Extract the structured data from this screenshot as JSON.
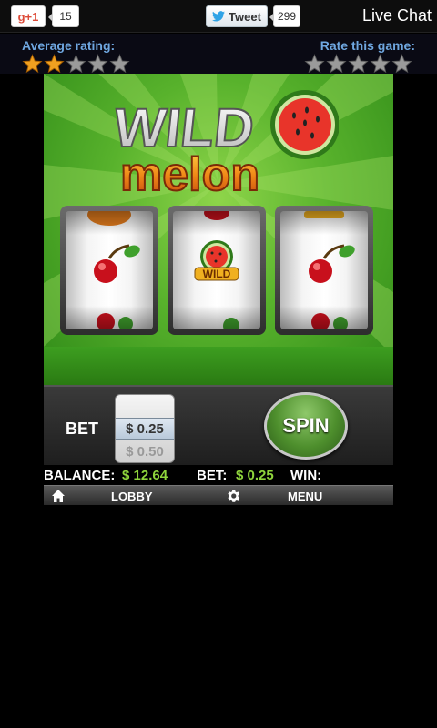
{
  "social": {
    "gplus_label": "g+1",
    "gplus_count": "15",
    "tweet_label": "Tweet",
    "tweet_count": "299",
    "live_chat": "Live Chat"
  },
  "rating": {
    "average_label": "Average rating:",
    "average_stars_filled": 2,
    "stars_total": 5,
    "rate_label": "Rate this game:",
    "rate_stars_filled": 0
  },
  "game": {
    "logo_line1": "WILD",
    "logo_line2": "melon",
    "reels": [
      {
        "symbols": [
          "orange",
          "cherry",
          "cherry-pair"
        ]
      },
      {
        "symbols": [
          "red",
          "wild-melon",
          "cherry"
        ]
      },
      {
        "symbols": [
          "wild-partial",
          "cherry",
          "cherry-pair"
        ]
      }
    ],
    "wild_label": "WILD"
  },
  "controls": {
    "bet_label": "BET",
    "bet_options": [
      "$ 0.25",
      "$ 0.50"
    ],
    "bet_selected": "$ 0.25",
    "bet_next": "$ 0.50",
    "spin_label": "SPIN"
  },
  "info": {
    "balance_label": "BALANCE:",
    "balance_value": "$ 12.64",
    "bet_label": "BET:",
    "bet_value": "$ 0.25",
    "win_label": "WIN:",
    "win_value": ""
  },
  "menubar": {
    "home_icon": "home-icon",
    "lobby_label": "LOBBY",
    "settings_icon": "gear-icon",
    "menu_label": "MENU"
  },
  "colors": {
    "accent_green": "#8fd43c",
    "label_blue": "#6fa7e0",
    "star_gold": "#f0a020"
  }
}
